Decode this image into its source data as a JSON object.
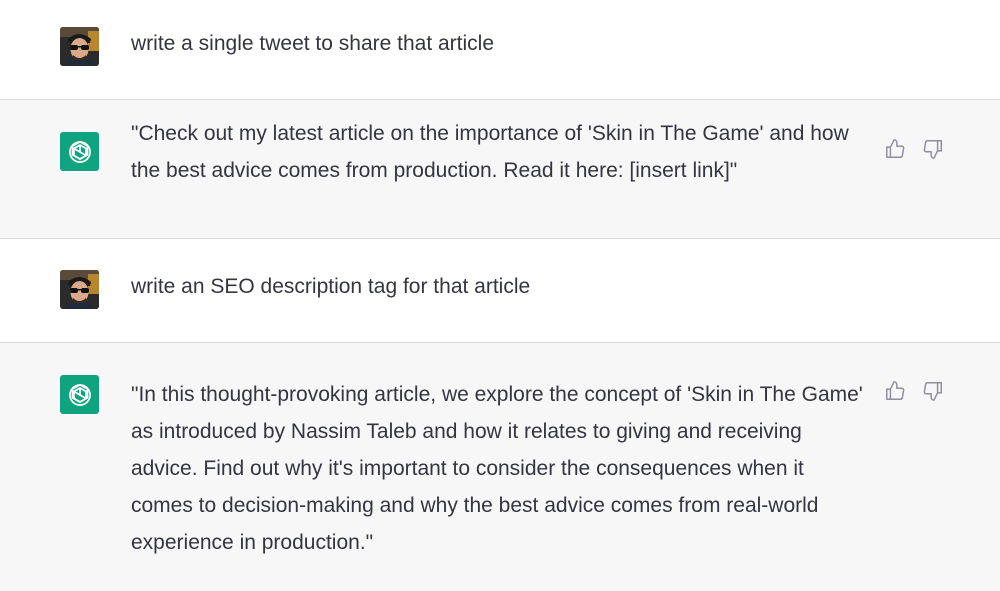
{
  "messages": [
    {
      "role": "user",
      "text": "write a single tweet to share that article",
      "avatar_icon": "user-photo-avatar"
    },
    {
      "role": "assistant",
      "text": "\"Check out my latest article on the importance of 'Skin in The Game' and how the best advice comes from production. Read it here: [insert link]\"",
      "avatar_icon": "openai-logo-icon"
    },
    {
      "role": "user",
      "text": "write an SEO description tag for that article",
      "avatar_icon": "user-photo-avatar"
    },
    {
      "role": "assistant",
      "text": "\"In this thought-provoking article, we explore the concept of 'Skin in The Game' as introduced by Nassim Taleb and how it relates to giving and receiving advice. Find out why it's important to consider the consequences when it comes to decision-making and why the best advice comes from real-world experience in production.\"",
      "avatar_icon": "openai-logo-icon"
    }
  ],
  "feedback_icons": [
    "thumbs-up-icon",
    "thumbs-down-icon"
  ],
  "colors": {
    "user_bg": "#ffffff",
    "assistant_bg": "#f7f7f8",
    "text": "#343541",
    "bot_avatar": "#10a37f",
    "icon": "#acacbe"
  }
}
